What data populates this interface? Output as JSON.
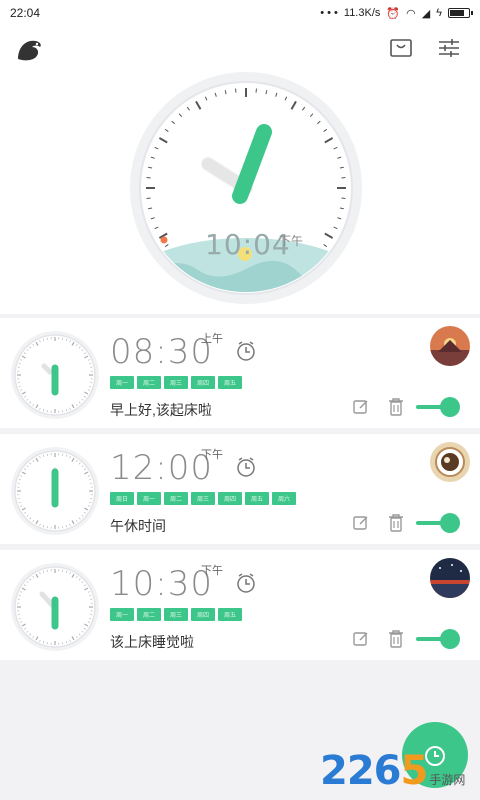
{
  "status_bar": {
    "time": "22:04",
    "speed": "11.3K/s"
  },
  "header": {
    "big_clock": {
      "time": "10:04",
      "ampm": "下午"
    }
  },
  "alarms": [
    {
      "time": "08:30",
      "ampm": "上午",
      "days": [
        "周一",
        "周二",
        "周三",
        "周四",
        "周五"
      ],
      "label": "早上好,该起床啦",
      "enabled": true,
      "avatar": "sunset-avatar"
    },
    {
      "time": "12:00",
      "ampm": "下午",
      "days": [
        "周日",
        "周一",
        "周二",
        "周三",
        "周四",
        "周五",
        "周六"
      ],
      "label": "午休时间",
      "enabled": true,
      "avatar": "coffee-avatar"
    },
    {
      "time": "10:30",
      "ampm": "下午",
      "days": [
        "周一",
        "周二",
        "周三",
        "周四",
        "周五"
      ],
      "label": "该上床睡觉啦",
      "enabled": true,
      "avatar": "night-avatar"
    }
  ],
  "watermark": {
    "number_a": "226",
    "number_b": "5",
    "site": "手游网"
  },
  "colors": {
    "accent": "#3cc68a",
    "background": "#f2f2f4"
  }
}
